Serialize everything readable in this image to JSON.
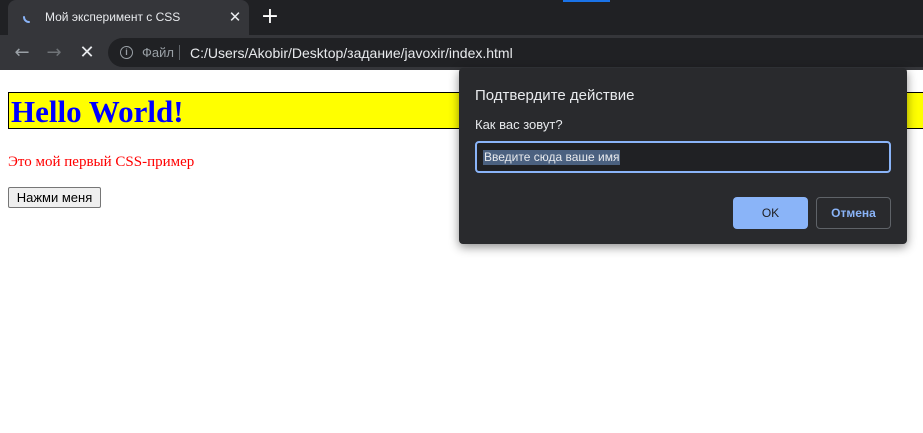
{
  "browser": {
    "tab": {
      "title": "Мой эксперимент с CSS",
      "close_icon": "close-icon",
      "loading": true
    },
    "new_tab_icon": "plus-icon",
    "toolbar": {
      "back_icon": "arrow-left-icon",
      "forward_icon": "arrow-right-icon",
      "stop_icon": "close-icon",
      "info_label": "Файл",
      "url": "C:/Users/Akobir/Desktop/задание/javoxir/index.html"
    }
  },
  "page": {
    "heading": "Hello World!",
    "paragraph": "Это мой первый CSS-пример",
    "button_label": "Нажми меня",
    "colors": {
      "heading_bg": "#ffff00",
      "heading_text": "#0000ff",
      "paragraph_text": "#ff0000"
    }
  },
  "dialog": {
    "title": "Подтвердите действие",
    "message": "Как вас зовут?",
    "input_value": "Введите сюда ваше имя",
    "ok_label": "OK",
    "cancel_label": "Отмена",
    "colors": {
      "accent": "#8ab4f8",
      "background": "#292a2d"
    }
  }
}
